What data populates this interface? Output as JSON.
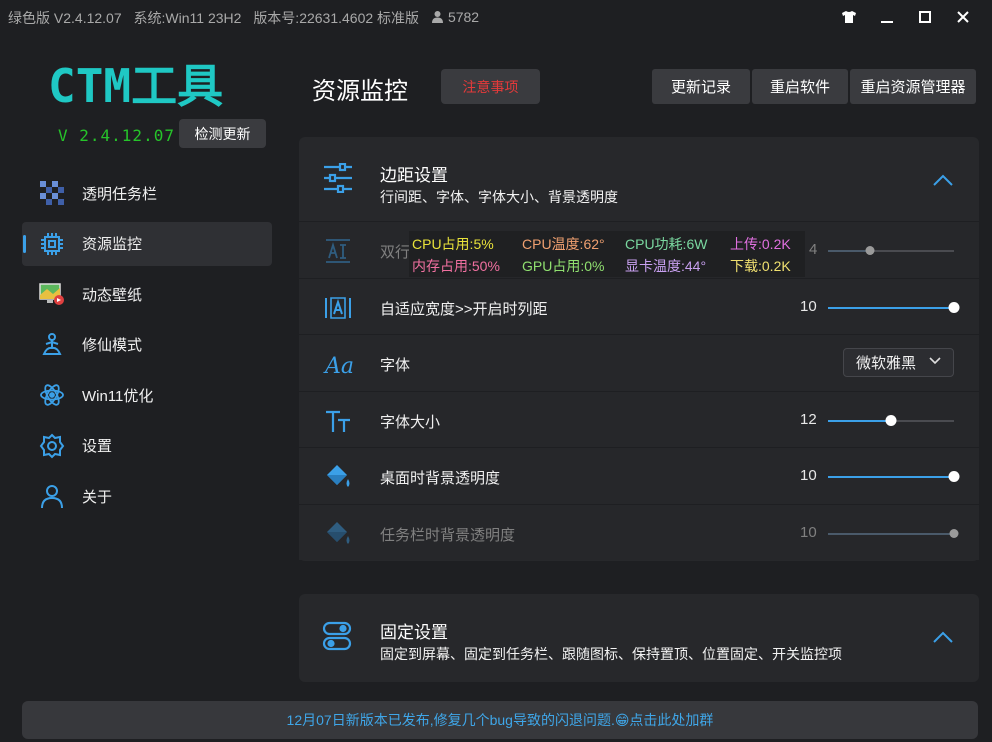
{
  "titlebar": {
    "edition": "绿色版 V2.4.12.07",
    "system": "系统:Win11 23H2",
    "build": "版本号:22631.4602 标准版",
    "user_count": "5782"
  },
  "sidebar": {
    "logo_text": "CTM工具",
    "version": "V 2.4.12.07",
    "check_update": "检测更新",
    "items": [
      {
        "label": "透明任务栏",
        "icon": "checker-icon"
      },
      {
        "label": "资源监控",
        "icon": "chip-icon",
        "active": true
      },
      {
        "label": "动态壁纸",
        "icon": "wallpaper-icon"
      },
      {
        "label": "修仙模式",
        "icon": "meditation-icon"
      },
      {
        "label": "Win11优化",
        "icon": "atom-icon"
      },
      {
        "label": "设置",
        "icon": "gear-icon"
      },
      {
        "label": "关于",
        "icon": "person-icon"
      }
    ]
  },
  "header": {
    "title": "资源监控",
    "notice": "注意事项",
    "buttons": [
      "更新记录",
      "重启软件",
      "重启资源管理器"
    ]
  },
  "margin_panel": {
    "title": "边距设置",
    "subtitle": "行间距、字体、字体大小、背景透明度",
    "rows": [
      {
        "label": "双行",
        "value": "4",
        "level": 0.33,
        "icon": "text-box-icon",
        "disabled": true
      },
      {
        "label": "自适应宽度>>开启时列距",
        "value": "10",
        "level": 1.0,
        "icon": "width-icon"
      },
      {
        "label": "字体",
        "dropdown": "微软雅黑",
        "icon": "font-icon"
      },
      {
        "label": "字体大小",
        "value": "12",
        "level": 0.5,
        "icon": "font-size-icon"
      },
      {
        "label": "桌面时背景透明度",
        "value": "10",
        "level": 1.0,
        "icon": "paint-bucket-icon"
      },
      {
        "label": "任务栏时背景透明度",
        "value": "10",
        "level": 1.0,
        "icon": "paint-bucket-icon",
        "disabled": true
      }
    ]
  },
  "monitor": {
    "cpu_usage": "CPU占用:5%",
    "cpu_temp": "CPU温度:62°",
    "cpu_power": "CPU功耗:6W",
    "upload": "上传:0.2K",
    "mem_usage": "内存占用:50%",
    "gpu_usage": "GPU占用:0%",
    "gpu_temp": "显卡温度:44°",
    "download": "下载:0.2K"
  },
  "fixed_panel": {
    "title": "固定设置",
    "subtitle": "固定到屏幕、固定到任务栏、跟随图标、保持置顶、位置固定、开关监控项"
  },
  "footer": {
    "text": "12月07日新版本已发布,修复几个bug导致的闪退问题.😁点击此处加群"
  },
  "colors": {
    "accent": "#3ba0e8",
    "notice": "#e43a3a",
    "version": "#26c42a",
    "logo": "#1fc8c4",
    "cpu_usage": "#e8e23a",
    "cpu_temp": "#f0a070",
    "cpu_power": "#7ad8a0",
    "upload": "#e070e0",
    "mem_usage": "#f070a0",
    "gpu_usage": "#90e070",
    "gpu_temp": "#c8a0f0",
    "download": "#f0e070"
  }
}
